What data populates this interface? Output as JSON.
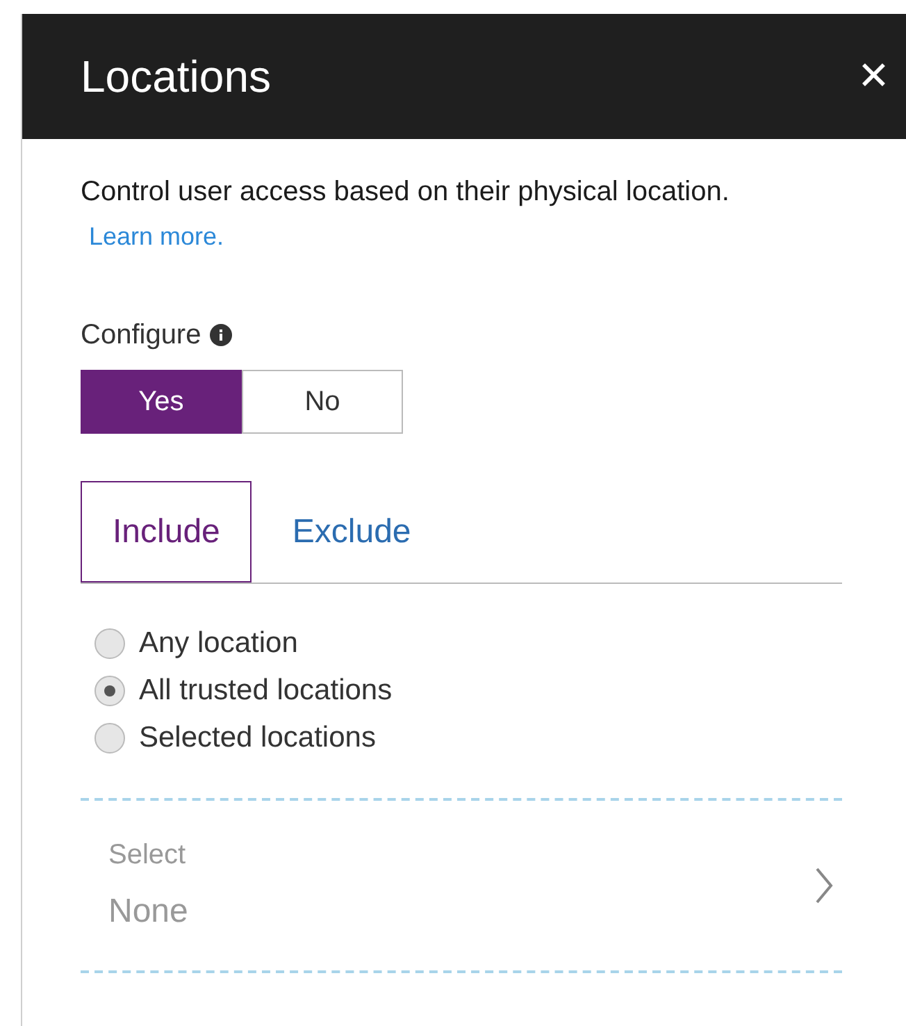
{
  "window": {
    "title": "Locations",
    "close": "✕"
  },
  "description": {
    "text": "Control user access based on their physical location.",
    "link": "Learn more."
  },
  "configure": {
    "label": "Configure",
    "options": [
      {
        "label": "Yes",
        "selected": true
      },
      {
        "label": "No",
        "selected": false
      }
    ]
  },
  "tabs": [
    {
      "label": "Include",
      "selected": true
    },
    {
      "label": "Exclude",
      "selected": false
    }
  ],
  "location_options": [
    {
      "label": "Any location",
      "selected": false
    },
    {
      "label": "All trusted locations",
      "selected": true
    },
    {
      "label": "Selected locations",
      "selected": false
    }
  ],
  "selector": {
    "label": "Select",
    "value": "None"
  }
}
